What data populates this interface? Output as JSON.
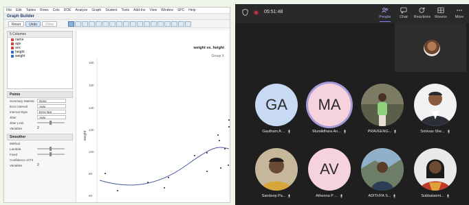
{
  "jmp": {
    "menu": [
      "File",
      "Edit",
      "Tables",
      "Rows",
      "Cols",
      "DOE",
      "Analyze",
      "Graph",
      "Student",
      "Tools",
      "Add-Ins",
      "View",
      "Window",
      "SPC",
      "Help"
    ],
    "window_title": "Graph Builder",
    "buttons": {
      "reset": "Reset",
      "undo": "Undo",
      "done": "Done"
    },
    "columns": {
      "header": "5 Columns",
      "items": [
        {
          "name": "name",
          "type": "nominal"
        },
        {
          "name": "age",
          "type": "nominal"
        },
        {
          "name": "sex",
          "type": "nominal"
        },
        {
          "name": "height",
          "type": "continuous"
        },
        {
          "name": "weight",
          "type": "continuous"
        }
      ]
    },
    "points_section": {
      "title": "Points",
      "options": [
        {
          "label": "Summary Statistic",
          "value": "None"
        },
        {
          "label": "Error Interval",
          "value": "Auto"
        },
        {
          "label": "Interval Style",
          "value": "Error Bar"
        },
        {
          "label": "Jitter",
          "value": "Auto"
        },
        {
          "label": "Jitter Limit",
          "value": ""
        },
        {
          "label": "Variables",
          "value": "2"
        }
      ]
    },
    "smoother_section": {
      "title": "Smoother",
      "options": [
        {
          "label": "Method",
          "value": ""
        },
        {
          "label": "Lambda",
          "value": ""
        },
        {
          "label": "Fixed",
          "value": ""
        },
        {
          "label": "Confidence of Fit",
          "value": ""
        },
        {
          "label": "Variables",
          "value": "2"
        }
      ]
    },
    "plot": {
      "title": "weight vs. height",
      "group_label": "Group X",
      "y_label": "weight",
      "y_ticks": [
        "180",
        "160",
        "140",
        "120",
        "100",
        "80",
        "60"
      ]
    }
  },
  "teams": {
    "timer": "05:51:48",
    "nav": [
      {
        "label": "People",
        "icon": "people-icon",
        "active": true
      },
      {
        "label": "Chat",
        "icon": "chat-icon",
        "active": false
      },
      {
        "label": "Reactions",
        "icon": "reactions-icon",
        "active": false
      },
      {
        "label": "Rooms",
        "icon": "rooms-icon",
        "active": false
      },
      {
        "label": "More",
        "icon": "more-icon",
        "active": false
      }
    ],
    "participants": [
      {
        "name": "Gautham A ...",
        "initials": "GA",
        "kind": "initials"
      },
      {
        "name": "Muralidhara An...",
        "initials": "MA",
        "kind": "initials"
      },
      {
        "name": "PRAVEENG...",
        "initials": "",
        "kind": "photo"
      },
      {
        "name": "Srinivas She...",
        "initials": "",
        "kind": "photo"
      },
      {
        "name": "Sandeep Pa...",
        "initials": "",
        "kind": "photo"
      },
      {
        "name": "Atheena P ...",
        "initials": "AV",
        "kind": "initials"
      },
      {
        "name": "ADITHYA S...",
        "initials": "",
        "kind": "photo"
      },
      {
        "name": "Subbalaxmi...",
        "initials": "",
        "kind": "photo"
      }
    ],
    "colors": {
      "background": "#1f1f1f",
      "accent": "#7f85f5",
      "record": "#c4314b"
    }
  }
}
